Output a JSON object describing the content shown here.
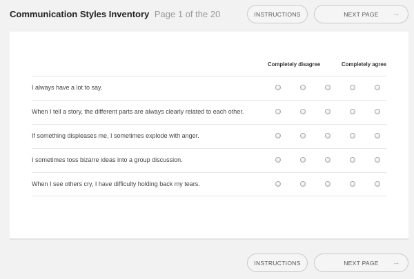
{
  "header": {
    "title": "Communication Styles Inventory",
    "subtitle": "Page 1 of the 20"
  },
  "buttons": {
    "instructions": "INSTRUCTIONS",
    "next_page": "NEXT PAGE",
    "next_arrow": "→"
  },
  "scale": {
    "left_label": "Completely disagree",
    "right_label": "Completely agree",
    "points": 5
  },
  "questions": [
    {
      "text": "I always have a lot to say.",
      "selected": null
    },
    {
      "text": "When I tell a story, the different parts are always clearly related to each other.",
      "selected": null
    },
    {
      "text": "If something displeases me, I sometimes explode with anger.",
      "selected": null
    },
    {
      "text": "I sometimes toss bizarre ideas into a group discussion.",
      "selected": null
    },
    {
      "text": "When I see others cry, I have difficulty holding back my tears.",
      "selected": null
    }
  ]
}
